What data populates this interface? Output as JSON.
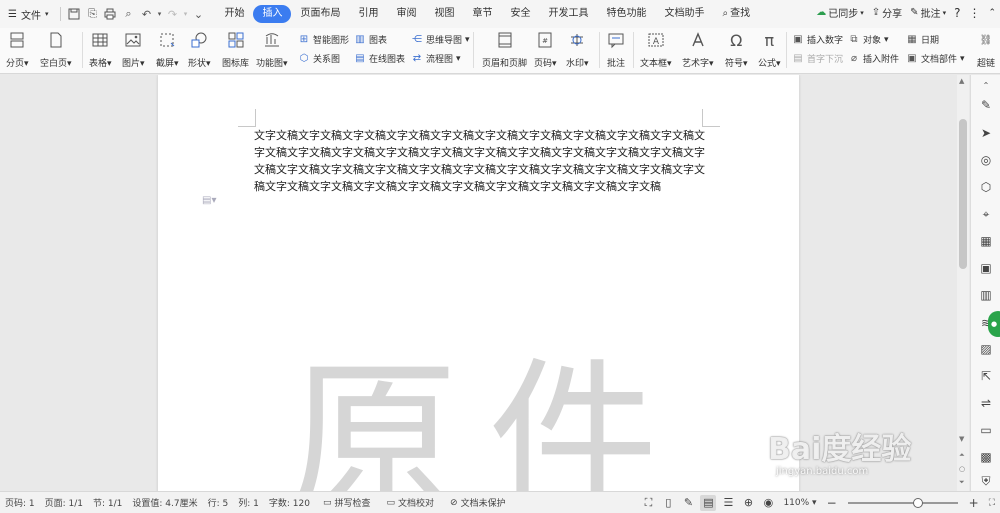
{
  "menubar": {
    "file_label": "文件",
    "tabs": [
      {
        "label": "开始",
        "active": false
      },
      {
        "label": "插入",
        "active": true
      },
      {
        "label": "页面布局",
        "active": false
      },
      {
        "label": "引用",
        "active": false
      },
      {
        "label": "审阅",
        "active": false
      },
      {
        "label": "视图",
        "active": false
      },
      {
        "label": "章节",
        "active": false
      },
      {
        "label": "安全",
        "active": false
      },
      {
        "label": "开发工具",
        "active": false
      },
      {
        "label": "特色功能",
        "active": false
      },
      {
        "label": "文档助手",
        "active": false
      }
    ],
    "search_label": "查找",
    "sync_label": "已同步",
    "share_label": "分享",
    "comment_label": "批注",
    "accent_color": "#3b7cf0"
  },
  "ribbon": {
    "page_break": "分页",
    "blank_page": "空白页",
    "table": "表格",
    "picture": "图片",
    "screenshot": "截屏",
    "shapes": "形状",
    "icon_library": "图标库",
    "function_chart": "功能图",
    "smart_shape": "智能图形",
    "chart": "图表",
    "mind_map": "思维导图",
    "relation_chart": "关系图",
    "online_chart": "在线图表",
    "flow_chart": "流程图",
    "header_footer": "页眉和页脚",
    "page_number": "页码",
    "watermark": "水印",
    "comment": "批注",
    "text_box": "文本框",
    "word_art": "艺术字",
    "symbol": "符号",
    "formula": "公式",
    "insert_number": "插入数字",
    "object": "对象",
    "date": "日期",
    "drop_cap": "首字下沉",
    "attachment": "插入附件",
    "doc_parts": "文档部件",
    "hyperlink": "超链"
  },
  "document": {
    "body_text": "文字文稿文字文稿文字文稿文字文稿文字文稿文字文稿文字文稿文字文稿文字文稿文字文稿文字文稿文字文稿文字文稿文字文稿文字文稿文字文稿文字文稿文字文稿文字文稿文字文稿文字文稿文字文稿文字文稿文字文稿文字文稿文字文稿文字文稿文字文稿文字文稿文字文稿文字文稿文字文稿文字文稿文字文稿文字文稿文字文稿文字文稿文字文稿文字文稿文字文稿",
    "watermark_text": "原件"
  },
  "baidu_watermark": {
    "logo_text": "Bai度经验",
    "url": "jingyan.baidu.com"
  },
  "statusbar": {
    "page_num": "页码: 1",
    "page_count": "页面: 1/1",
    "section": "节: 1/1",
    "setting_value": "设置值: 4.7厘米",
    "row": "行: 5",
    "col": "列: 1",
    "word_count": "字数: 120",
    "spell_check": "拼写检查",
    "doc_proof": "文档校对",
    "doc_protect": "文档未保护",
    "zoom": "110%"
  }
}
